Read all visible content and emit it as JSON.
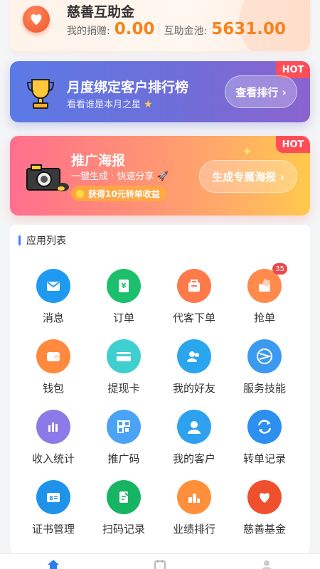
{
  "charity": {
    "title": "慈善互助金",
    "donation_label": "我的捐赠:",
    "donation_value": "0.00",
    "pool_label": "互助金池:",
    "pool_value": "5631.00",
    "icon": "heart-icon"
  },
  "rank_banner": {
    "hot": "HOT",
    "title": "月度绑定客户排行榜",
    "subtitle": "看看谁是本月之星",
    "button": "查看排行 ›",
    "icon": "trophy-icon"
  },
  "poster_banner": {
    "hot": "HOT",
    "title": "推广海报",
    "subtitle": "一键生成 · 快速分享",
    "reward": "获得10元转单收益",
    "button": "生成专属海报 ›",
    "icon": "camera-icon"
  },
  "app_list": {
    "title": "应用列表",
    "items": [
      {
        "label": "消息",
        "icon": "mail-icon",
        "color": "#1e9bf0"
      },
      {
        "label": "订单",
        "icon": "yuan-doc-icon",
        "color": "#1bbf6c"
      },
      {
        "label": "代客下单",
        "icon": "bag-icon",
        "color": "#ff7a4a"
      },
      {
        "label": "抢单",
        "icon": "grab-icon",
        "color": "#ff8a4c",
        "badge": "35"
      },
      {
        "label": "钱包",
        "icon": "wallet-icon",
        "color": "#ff8a3d"
      },
      {
        "label": "提现卡",
        "icon": "card-icon",
        "color": "#3fcfcf"
      },
      {
        "label": "我的好友",
        "icon": "friends-icon",
        "color": "#2aa6ef"
      },
      {
        "label": "服务技能",
        "icon": "skill-icon",
        "color": "#3b9af0"
      },
      {
        "label": "收入统计",
        "icon": "stats-icon",
        "color": "#8b7ae8"
      },
      {
        "label": "推广码",
        "icon": "qrcode-icon",
        "color": "#4aa3f5"
      },
      {
        "label": "我的客户",
        "icon": "customer-icon",
        "color": "#2ea2ef"
      },
      {
        "label": "转单记录",
        "icon": "transfer-icon",
        "color": "#2d8ff0"
      },
      {
        "label": "证书管理",
        "icon": "certificate-icon",
        "color": "#1f93ea"
      },
      {
        "label": "扫码记录",
        "icon": "scan-record-icon",
        "color": "#16b463"
      },
      {
        "label": "业绩排行",
        "icon": "ranking-icon",
        "color": "#ff8f3a"
      },
      {
        "label": "慈善基金",
        "icon": "charity-icon",
        "color": "#f0502e"
      }
    ]
  },
  "tabbar": {
    "tabs": [
      {
        "icon": "home-icon",
        "active": true
      },
      {
        "icon": "calendar-icon",
        "active": false
      },
      {
        "icon": "user-icon",
        "active": false
      }
    ]
  }
}
